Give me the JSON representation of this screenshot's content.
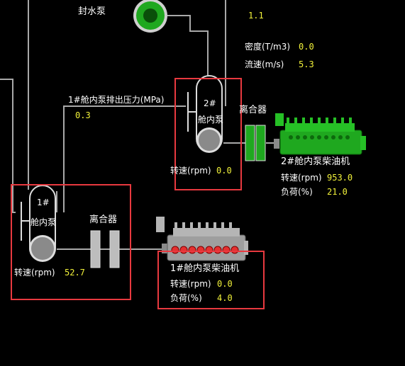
{
  "seal_pump": {
    "label": "封水泵"
  },
  "top_right": {
    "value_1": "1.1",
    "density_label": "密度(T/m3)",
    "density_value": "0.0",
    "flow_label": "流速(m/s)",
    "flow_value": "5.3"
  },
  "pressure": {
    "label": "1#舱内泵排出压力(MPa)",
    "value": "0.3"
  },
  "pump2": {
    "id_label": "2#",
    "name_label": "舱内泵",
    "speed_label": "转速(rpm)",
    "speed_value": "0.0",
    "clutch_label": "离合器"
  },
  "engine2": {
    "title": "2#舱内泵柴油机",
    "speed_label": "转速(rpm)",
    "speed_value": "953.0",
    "load_label": "负荷(%)",
    "load_value": "21.0"
  },
  "pump1": {
    "id_label": "1#",
    "name_label": "舱内泵",
    "speed_label": "转速(rpm)",
    "speed_value": "52.7",
    "clutch_label": "离合器"
  },
  "engine1": {
    "title": "1#舱内泵柴油机",
    "speed_label": "转速(rpm)",
    "speed_value": "0.0",
    "load_label": "负荷(%)",
    "load_value": "4.0"
  },
  "colors": {
    "pipe": "#a9a9a9",
    "highlight": "#e8393f",
    "value": "#f2f23a",
    "running_green": "#1fa81f",
    "stopped_gray": "#8a8a8a"
  }
}
